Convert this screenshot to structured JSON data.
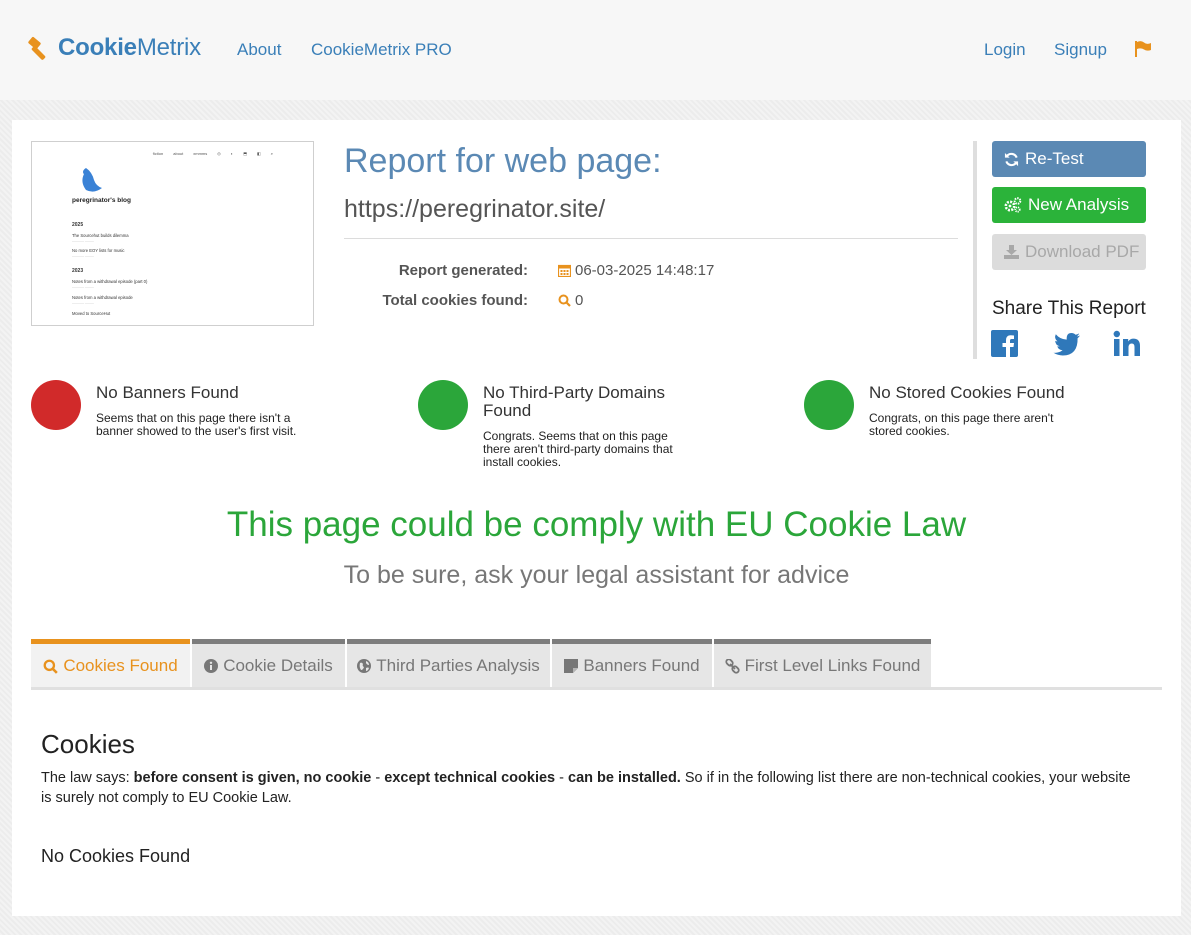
{
  "nav": {
    "brand_bold": "Cookie",
    "brand_rest": "Metrix",
    "about": "About",
    "pro": "CookieMetrix PRO",
    "login": "Login",
    "signup": "Signup"
  },
  "thumbnail": {
    "nav_items": [
      "fiction",
      "about",
      "xmmms",
      "◎",
      "◐",
      "⬒",
      "◧",
      "⌕"
    ],
    "blog_title": "peregrinator's blog",
    "year1": "2025",
    "post1": "The Sourcehut builds dilemma",
    "post2": "No more EOY lists for music",
    "year2": "2023",
    "post3": "Notes from a withdrawal episode (part 0)",
    "post4": "Notes from a withdrawal episode",
    "post5": "Moved to SourceHut"
  },
  "report": {
    "title": "Report for web page:",
    "url": "https://peregrinator.site/",
    "generated_label": "Report generated:",
    "generated_value": "06-03-2025 14:48:17",
    "total_label": "Total cookies found:",
    "total_value": "0"
  },
  "actions": {
    "retest": "Re-Test",
    "new_analysis": "New Analysis",
    "download_pdf": "Download PDF",
    "share_title": "Share This Report"
  },
  "results": [
    {
      "title": "No Banners Found",
      "text": "Seems that on this page there isn't a banner showed to the user's first visit.",
      "color": "#d12a2a"
    },
    {
      "title": "No Third-Party Domains Found",
      "text": "Congrats. Seems that on this page there aren't third-party domains that install cookies.",
      "color": "#2ba63a"
    },
    {
      "title": "No Stored Cookies Found",
      "text": "Congrats, on this page there aren't stored cookies.",
      "color": "#2ba63a"
    }
  ],
  "verdict": {
    "headline": "This page could be comply with EU Cookie Law",
    "advice": "To be sure, ask your legal assistant for advice"
  },
  "tabs": [
    {
      "label": "Cookies Found",
      "icon": "search-icon"
    },
    {
      "label": "Cookie Details",
      "icon": "info-icon"
    },
    {
      "label": "Third Parties Analysis",
      "icon": "globe-icon"
    },
    {
      "label": "Banners Found",
      "icon": "banner-icon"
    },
    {
      "label": "First Level Links Found",
      "icon": "link-icon"
    }
  ],
  "cookies_section": {
    "heading": "Cookies",
    "law_prefix": "The law says: ",
    "law_bold1": "before consent is given, no cookie",
    "law_mid": " - ",
    "law_bold2": "except technical cookies",
    "law_mid2": " - ",
    "law_bold3": "can be installed.",
    "law_suffix": " So if in the following list there are non-technical cookies, your website is surely not comply to EU Cookie Law.",
    "none_found": "No Cookies Found"
  },
  "colors": {
    "brand_blue": "#3a7fb8",
    "accent_orange": "#e8921e",
    "success_green": "#2bb33a",
    "danger_red": "#d12a2a"
  }
}
